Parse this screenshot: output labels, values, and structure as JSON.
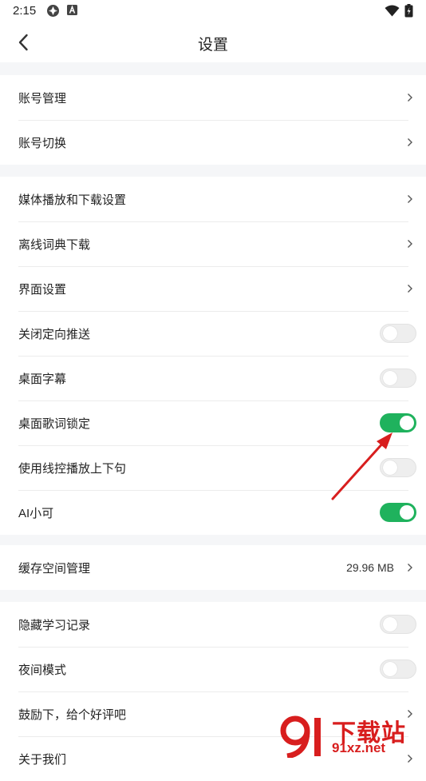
{
  "status_bar": {
    "time": "2:15"
  },
  "header": {
    "title": "设置"
  },
  "groups": [
    {
      "items": [
        {
          "label": "账号管理",
          "type": "nav"
        },
        {
          "label": "账号切换",
          "type": "nav"
        }
      ]
    },
    {
      "items": [
        {
          "label": "媒体播放和下载设置",
          "type": "nav"
        },
        {
          "label": "离线词典下载",
          "type": "nav"
        },
        {
          "label": "界面设置",
          "type": "nav"
        },
        {
          "label": "关闭定向推送",
          "type": "toggle",
          "on": false
        },
        {
          "label": "桌面字幕",
          "type": "toggle",
          "on": false
        },
        {
          "label": "桌面歌词锁定",
          "type": "toggle",
          "on": true
        },
        {
          "label": "使用线控播放上下句",
          "type": "toggle",
          "on": false
        },
        {
          "label": "AI小可",
          "type": "toggle",
          "on": true
        }
      ]
    },
    {
      "items": [
        {
          "label": "缓存空间管理",
          "type": "nav",
          "value": "29.96 MB"
        }
      ]
    },
    {
      "items": [
        {
          "label": "隐藏学习记录",
          "type": "toggle",
          "on": false
        },
        {
          "label": "夜间模式",
          "type": "toggle",
          "on": false
        },
        {
          "label": "鼓励下，给个好评吧",
          "type": "nav"
        },
        {
          "label": "关于我们",
          "type": "nav"
        }
      ]
    }
  ],
  "watermark": {
    "main": "下载站",
    "sub": "91xz.net"
  },
  "colors": {
    "toggle_on": "#1fb25d",
    "annotation_arrow": "#d81e1e"
  }
}
